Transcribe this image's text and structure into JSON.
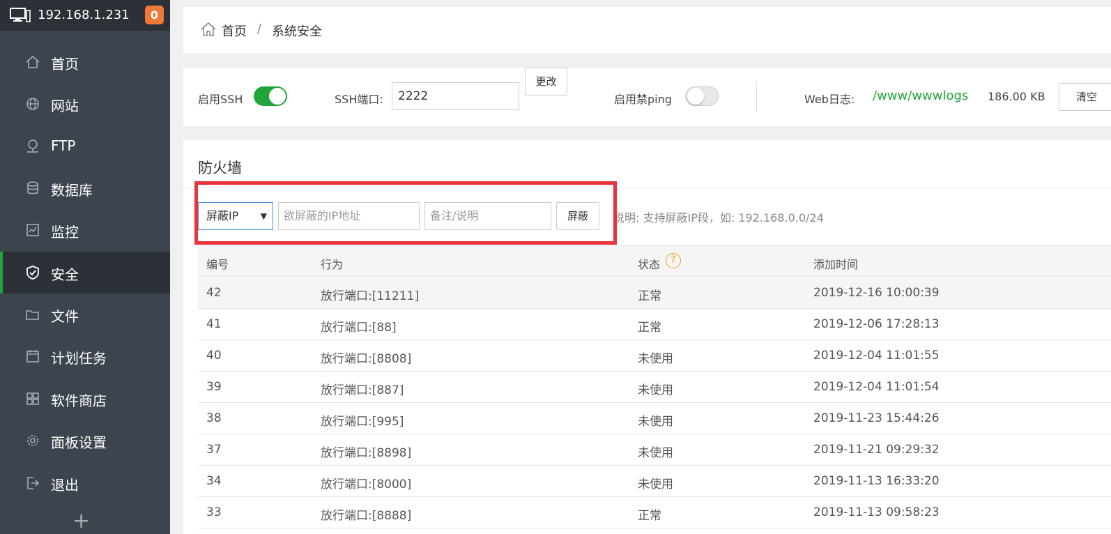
{
  "sidebar": {
    "host": "192.168.1.231",
    "badge": "0",
    "items": [
      {
        "label": "首页",
        "icon": "home-icon"
      },
      {
        "label": "网站",
        "icon": "globe-icon"
      },
      {
        "label": "FTP",
        "icon": "ftp-icon"
      },
      {
        "label": "数据库",
        "icon": "database-icon"
      },
      {
        "label": "监控",
        "icon": "monitor-icon"
      },
      {
        "label": "安全",
        "icon": "shield-icon",
        "active": true
      },
      {
        "label": "文件",
        "icon": "folder-icon"
      },
      {
        "label": "计划任务",
        "icon": "calendar-icon"
      },
      {
        "label": "软件商店",
        "icon": "apps-icon"
      },
      {
        "label": "面板设置",
        "icon": "gear-icon"
      },
      {
        "label": "退出",
        "icon": "logout-icon"
      }
    ],
    "plus": "+"
  },
  "breadcrumb": {
    "home": "首页",
    "separator": "/",
    "current": "系统安全"
  },
  "settings": {
    "ssh_label": "启用SSH",
    "ssh_enabled": true,
    "port_label": "SSH端口:",
    "port_value": "2222",
    "change_button": "更改",
    "ping_label": "启用禁ping",
    "ping_enabled": false,
    "weblog_label": "Web日志:",
    "weblog_path": "/www/wwwlogs",
    "weblog_size": "186.00 KB",
    "clear_button": "清空"
  },
  "firewall": {
    "title": "防火墙",
    "select_value": "屏蔽IP",
    "select_arrow": "▼",
    "ip_placeholder": "欲屏蔽的IP地址",
    "note_placeholder": "备注/说明",
    "block_button": "屏蔽",
    "hint": "说明: 支持屏蔽IP段，如: 192.168.0.0/24",
    "highlight_color": "#e8333a",
    "columns": [
      "编号",
      "行为",
      "状态",
      "添加时间"
    ],
    "help_icon": "?",
    "rows": [
      {
        "id": "42",
        "action": "放行端口:[11211]",
        "status": "正常",
        "time": "2019-12-16 10:00:39"
      },
      {
        "id": "41",
        "action": "放行端口:[88]",
        "status": "正常",
        "time": "2019-12-06 17:28:13"
      },
      {
        "id": "40",
        "action": "放行端口:[8808]",
        "status": "未使用",
        "time": "2019-12-04 11:01:55"
      },
      {
        "id": "39",
        "action": "放行端口:[887]",
        "status": "未使用",
        "time": "2019-12-04 11:01:54"
      },
      {
        "id": "38",
        "action": "放行端口:[995]",
        "status": "未使用",
        "time": "2019-11-23 15:44:26"
      },
      {
        "id": "37",
        "action": "放行端口:[8898]",
        "status": "未使用",
        "time": "2019-11-21 09:29:32"
      },
      {
        "id": "34",
        "action": "放行端口:[8000]",
        "status": "未使用",
        "time": "2019-11-13 16:33:20"
      },
      {
        "id": "33",
        "action": "放行端口:[8888]",
        "status": "正常",
        "time": "2019-11-13 09:58:23"
      }
    ]
  },
  "colors": {
    "accent": "#20a53a",
    "sidebar_bg": "#3c444d",
    "badge": "#f0793a"
  }
}
